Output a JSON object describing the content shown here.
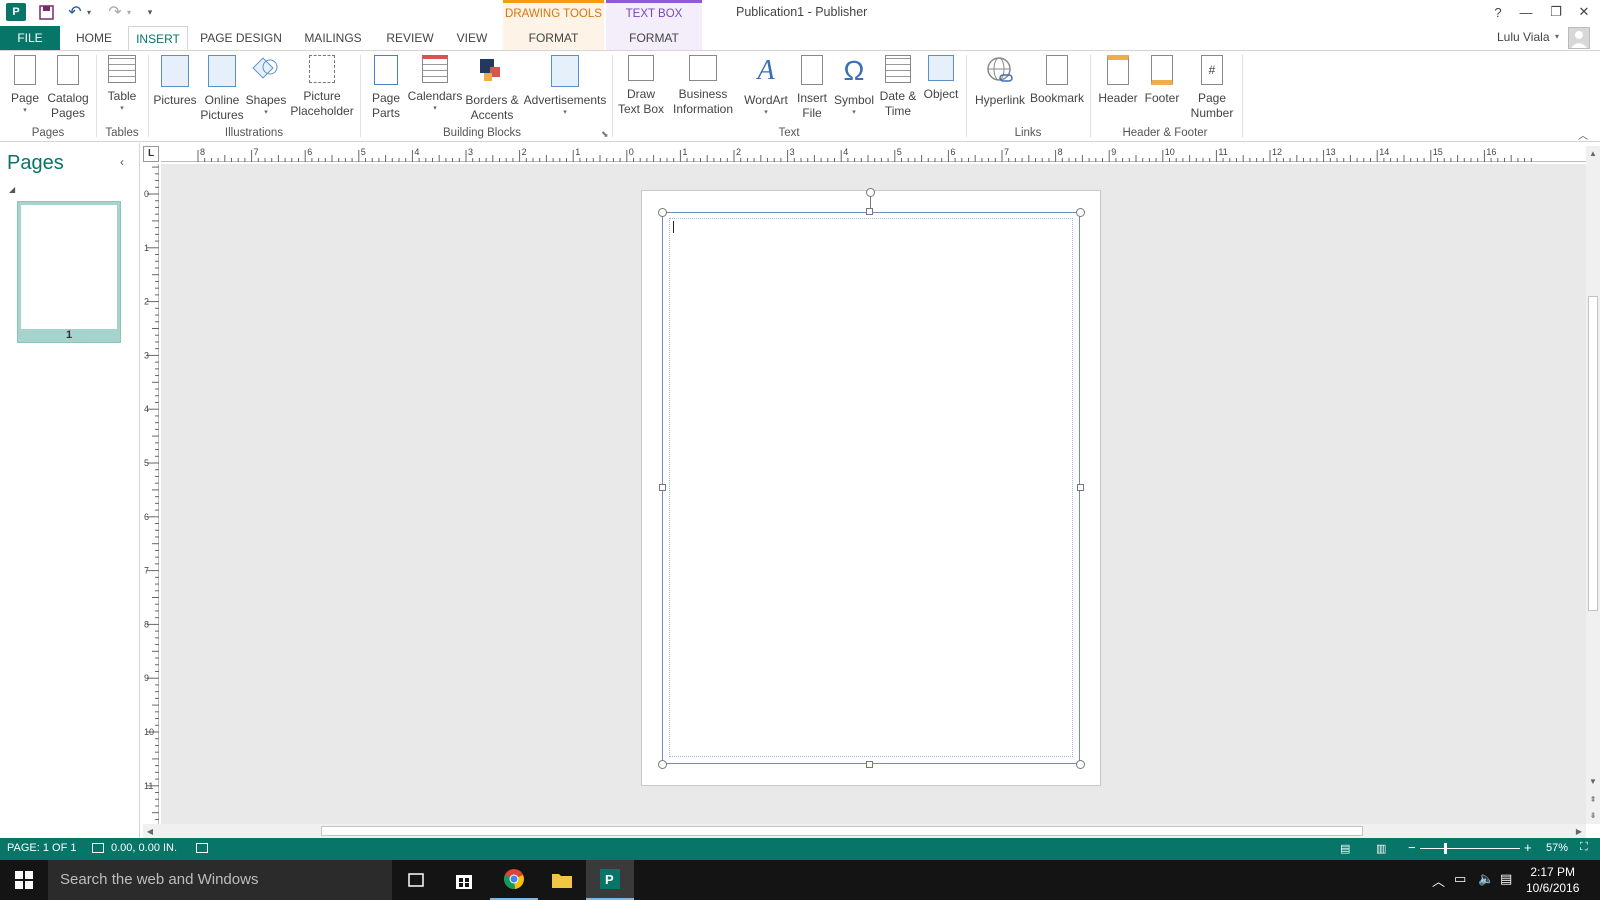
{
  "window": {
    "title": "Publication1 - Publisher",
    "drawing_tools_label": "DRAWING TOOLS",
    "text_box_tools_label": "TEXT BOX TOOLS",
    "user_name": "Lulu Viala",
    "help_glyph": "?",
    "minimize_glyph": "—",
    "restore_glyph": "❐",
    "close_glyph": "✕"
  },
  "qat": {
    "app_logo": "P",
    "save_glyph": "💾",
    "undo_glyph": "↶",
    "redo_glyph": "↷",
    "customize_glyph": "▾"
  },
  "tabs": [
    {
      "label": "FILE"
    },
    {
      "label": "HOME"
    },
    {
      "label": "INSERT"
    },
    {
      "label": "PAGE DESIGN"
    },
    {
      "label": "MAILINGS"
    },
    {
      "label": "REVIEW"
    },
    {
      "label": "VIEW"
    },
    {
      "label": "FORMAT"
    },
    {
      "label": "FORMAT"
    }
  ],
  "ribbon": {
    "groups": {
      "pages": "Pages",
      "tables": "Tables",
      "illustrations": "Illustrations",
      "building_blocks": "Building Blocks",
      "text": "Text",
      "links": "Links",
      "header_footer": "Header & Footer"
    },
    "buttons": {
      "page": [
        "Page",
        ""
      ],
      "catalog_pages": [
        "Catalog",
        "Pages"
      ],
      "table": [
        "Table",
        ""
      ],
      "pictures": [
        "Pictures",
        ""
      ],
      "online_pictures": [
        "Online",
        "Pictures"
      ],
      "shapes": [
        "Shapes",
        ""
      ],
      "picture_placeholder": [
        "Picture",
        "Placeholder"
      ],
      "page_parts": [
        "Page",
        "Parts"
      ],
      "calendars": [
        "Calendars",
        ""
      ],
      "borders_accents": [
        "Borders &",
        "Accents"
      ],
      "advertisements": [
        "Advertisements",
        ""
      ],
      "draw_text_box": [
        "Draw",
        "Text Box"
      ],
      "business_information": [
        "Business",
        "Information"
      ],
      "wordart": [
        "WordArt",
        ""
      ],
      "insert_file": [
        "Insert",
        "File"
      ],
      "symbol": [
        "Symbol",
        ""
      ],
      "date_time": [
        "Date &",
        "Time"
      ],
      "object": [
        "Object",
        ""
      ],
      "hyperlink": [
        "Hyperlink",
        ""
      ],
      "bookmark": [
        "Bookmark",
        ""
      ],
      "header": [
        "Header",
        ""
      ],
      "footer": [
        "Footer",
        ""
      ],
      "page_number": [
        "Page",
        "Number"
      ]
    }
  },
  "pages_pane": {
    "title": "Pages",
    "collapse_glyph": "‹",
    "thumb_number": "1"
  },
  "ruler": {
    "corner": "L",
    "h_labels": [
      "8",
      "7",
      "6",
      "5",
      "4",
      "3",
      "2",
      "1",
      "0",
      "1",
      "2",
      "3",
      "4",
      "5",
      "6",
      "7",
      "8",
      "9",
      "10",
      "11",
      "12",
      "13",
      "14",
      "15",
      "16"
    ],
    "v_labels": [
      "0",
      "1",
      "2",
      "3",
      "4",
      "5",
      "6",
      "7",
      "8",
      "9",
      "10",
      "11"
    ]
  },
  "statusbar": {
    "page": "PAGE: 1 OF 1",
    "position": "0.00, 0.00 IN.",
    "zoom": "57%"
  },
  "taskbar": {
    "search_placeholder": "Search the web and Windows",
    "time": "2:17 PM",
    "date": "10/6/2016"
  }
}
